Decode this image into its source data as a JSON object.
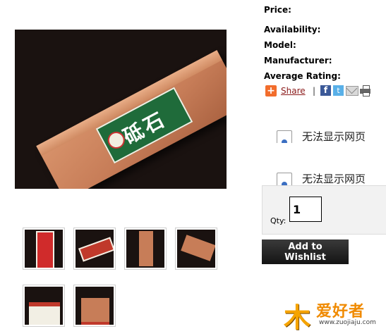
{
  "product": {
    "main_image_alt": "Whetstone with green label"
  },
  "info": {
    "price_label": "Price:",
    "availability_label": "Availability:",
    "model_label": "Model:",
    "manufacturer_label": "Manufacturer:",
    "rating_label": "Average Rating:"
  },
  "share": {
    "plus": "+",
    "label": "Share",
    "separator": "|",
    "facebook_glyph": "f",
    "twitter_glyph": "t"
  },
  "broken_frames": [
    {
      "message": "无法显示网页"
    },
    {
      "message": "无法显示网页"
    }
  ],
  "purchase": {
    "qty_label": "Qty:",
    "qty_value": "1",
    "wishlist_label": "Add to Wishlist"
  },
  "main_label_text": "砥石",
  "watermark": {
    "mark": "木",
    "text": "爱好者",
    "url": "www.zuojiaju.com"
  },
  "colors": {
    "label_green": "#1f6b3a",
    "stone": "#c77d58",
    "share_link": "#8b1a1a",
    "button_bg": "#141414",
    "watermark": "#f6a400"
  }
}
